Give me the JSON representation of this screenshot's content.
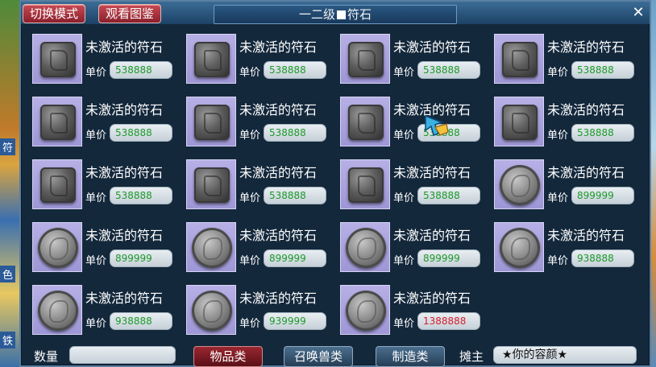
{
  "side_labels": [
    "符",
    "色",
    "铁"
  ],
  "toolbar": {
    "switch_mode": "切换模式",
    "view_catalog": "观看图鉴"
  },
  "window": {
    "title_left": "一二级",
    "title_right": "符石"
  },
  "price_label": "单价",
  "items": [
    {
      "name": "未激活的符石",
      "price": "538888",
      "stone": "square",
      "price_color": "green"
    },
    {
      "name": "未激活的符石",
      "price": "538888",
      "stone": "square",
      "price_color": "green"
    },
    {
      "name": "未激活的符石",
      "price": "538888",
      "stone": "square",
      "price_color": "green"
    },
    {
      "name": "未激活的符石",
      "price": "538888",
      "stone": "square",
      "price_color": "green"
    },
    {
      "name": "未激活的符石",
      "price": "538888",
      "stone": "square",
      "price_color": "green"
    },
    {
      "name": "未激活的符石",
      "price": "538888",
      "stone": "square",
      "price_color": "green"
    },
    {
      "name": "未激活的符石",
      "price": "538888",
      "stone": "square",
      "price_color": "green"
    },
    {
      "name": "未激活的符石",
      "price": "538888",
      "stone": "square",
      "price_color": "green"
    },
    {
      "name": "未激活的符石",
      "price": "538888",
      "stone": "square",
      "price_color": "green"
    },
    {
      "name": "未激活的符石",
      "price": "538888",
      "stone": "square",
      "price_color": "green"
    },
    {
      "name": "未激活的符石",
      "price": "538888",
      "stone": "square",
      "price_color": "green"
    },
    {
      "name": "未激活的符石",
      "price": "899999",
      "stone": "round",
      "price_color": "green"
    },
    {
      "name": "未激活的符石",
      "price": "899999",
      "stone": "round",
      "price_color": "green"
    },
    {
      "name": "未激活的符石",
      "price": "899999",
      "stone": "round",
      "price_color": "green"
    },
    {
      "name": "未激活的符石",
      "price": "899999",
      "stone": "round",
      "price_color": "green"
    },
    {
      "name": "未激活的符石",
      "price": "938888",
      "stone": "round",
      "price_color": "green"
    },
    {
      "name": "未激活的符石",
      "price": "938888",
      "stone": "round",
      "price_color": "green"
    },
    {
      "name": "未激活的符石",
      "price": "939999",
      "stone": "round",
      "price_color": "green"
    },
    {
      "name": "未激活的符石",
      "price": "1388888",
      "stone": "round",
      "price_color": "red"
    }
  ],
  "bottom": {
    "quantity_label": "数量",
    "quantity_value": "",
    "tab_items": "物品类",
    "tab_summons": "召唤兽类",
    "tab_crafting": "制造类",
    "owner_label": "摊主",
    "owner_name": "★你的容颜★"
  },
  "colors": {
    "price_green": "#1e9a2a",
    "price_red": "#d21e2e",
    "active_tab": "#9a2630"
  }
}
